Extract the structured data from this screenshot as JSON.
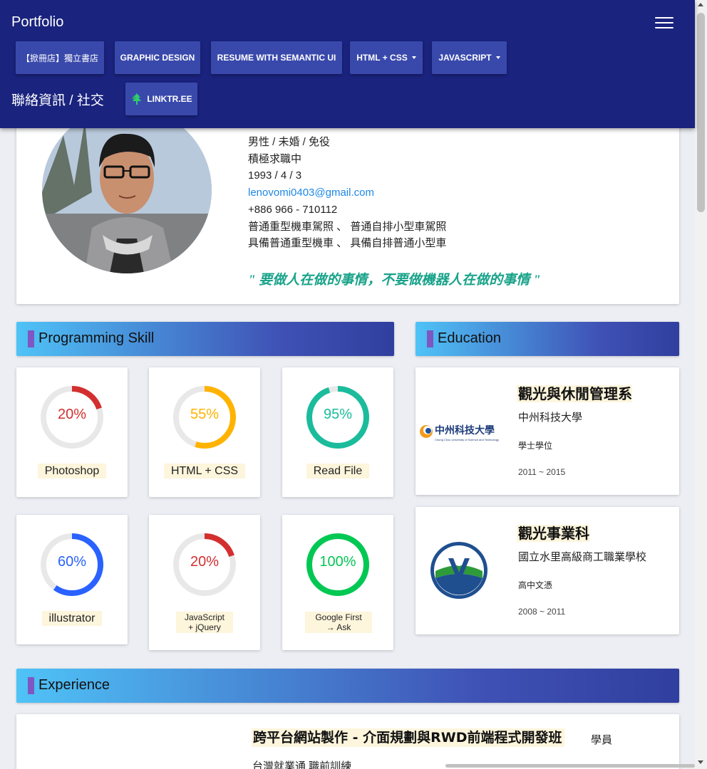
{
  "navbar": {
    "brand": "Portfolio",
    "items": [
      {
        "label": "【掀冊店】獨立書店",
        "dropdown": false
      },
      {
        "label": "GRAPHIC DESIGN",
        "dropdown": false
      },
      {
        "label": "RESUME WITH SEMANTIC UI",
        "dropdown": false
      },
      {
        "label": "HTML + CSS",
        "dropdown": true
      },
      {
        "label": "JAVASCRIPT",
        "dropdown": true
      }
    ],
    "contact_label": "聯絡資訊 / 社交",
    "linktree_label": "LINKTR.EE",
    "colors": {
      "bar": "#1a237e",
      "button": "#3949ab",
      "linktree_icon": "#2ecc71"
    }
  },
  "profile": {
    "lines": [
      "男性 / 未婚 / 免役",
      "積極求職中",
      "1993 / 4 / 3"
    ],
    "email": "lenovomi0403@gmail.com",
    "phone": "+886 966 - 710112",
    "license_lines": [
      "普通重型機車駕照 、 普通自排小型車駕照",
      "具備普通重型機車 、 具備自排普通小型車"
    ],
    "quote": "\" 要做人在做的事情，不要做機器人在做的事情 \""
  },
  "sections": {
    "skills": "Programming  Skill",
    "education": "Education",
    "experience": "Experience"
  },
  "skills": [
    {
      "name": "Photoshop",
      "percent": 20,
      "percent_label": "20%",
      "color": "#d32f2f"
    },
    {
      "name": "HTML + CSS",
      "percent": 55,
      "percent_label": "55%",
      "color": "#ffb300"
    },
    {
      "name": "Read  File",
      "percent": 95,
      "percent_label": "95%",
      "color": "#1abc9c"
    },
    {
      "name": "illustrator",
      "percent": 60,
      "percent_label": "60%",
      "color": "#2962ff"
    },
    {
      "name": "JavaScript + jQuery",
      "percent": 20,
      "percent_label": "20%",
      "color": "#d32f2f"
    },
    {
      "name": "Google  First → Ask",
      "percent": 100,
      "percent_label": "100%",
      "color": "#00c853"
    }
  ],
  "education": [
    {
      "title": "觀光與休閒管理系",
      "school": "中州科技大學",
      "degree": "學士學位",
      "years": "2011 ~ 2015",
      "logo_text": "中州科技大學",
      "logo_subtext": "Chung Chou University of Science and Technology"
    },
    {
      "title": "觀光事業科",
      "school": "國立水里高級商工職業學校",
      "degree": "高中文憑",
      "years": "2008 ~ 2011"
    }
  ],
  "experience": [
    {
      "title": "跨平台網站製作 - 介面規劃與RWD前端程式開發班",
      "role": "學員",
      "org": "台灣就業通 職前訓練"
    }
  ]
}
